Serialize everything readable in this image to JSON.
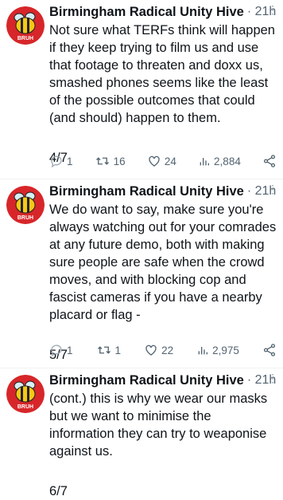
{
  "tweets": [
    {
      "author": "Birmingham Radical Unity Hive",
      "time": "· 21h",
      "text": "Not sure what TERFs think will happen if they keep trying to film us and use that footage to threaten and doxx us, smashed phones seems like the least of the possible outcomes that could (and should) happen to them.",
      "thread_count": "4/7",
      "replies": "1",
      "retweets": "16",
      "likes": "24",
      "views": "2,884"
    },
    {
      "author": "Birmingham Radical Unity Hive",
      "time": "· 21h",
      "text": "We do want to say, make sure you're always watching out for your comrades at any future demo, both with making sure people are safe when the crowd moves, and with blocking cop and fascist cameras if you have a nearby placard or flag -",
      "thread_count": "5/7",
      "replies": "1",
      "retweets": "1",
      "likes": "22",
      "views": "2,975"
    },
    {
      "author": "Birmingham Radical Unity Hive",
      "time": "· 21h",
      "text": "(cont.) this is why we wear our masks but we want to minimise the information they can try to weaponise against us.",
      "thread_count": "6/7"
    }
  ],
  "avatar_text": "BRUH",
  "colors": {
    "avatar_bg": "#d7262a",
    "bee_yellow": "#f6c915",
    "text": "#0f1419",
    "muted": "#536471"
  }
}
